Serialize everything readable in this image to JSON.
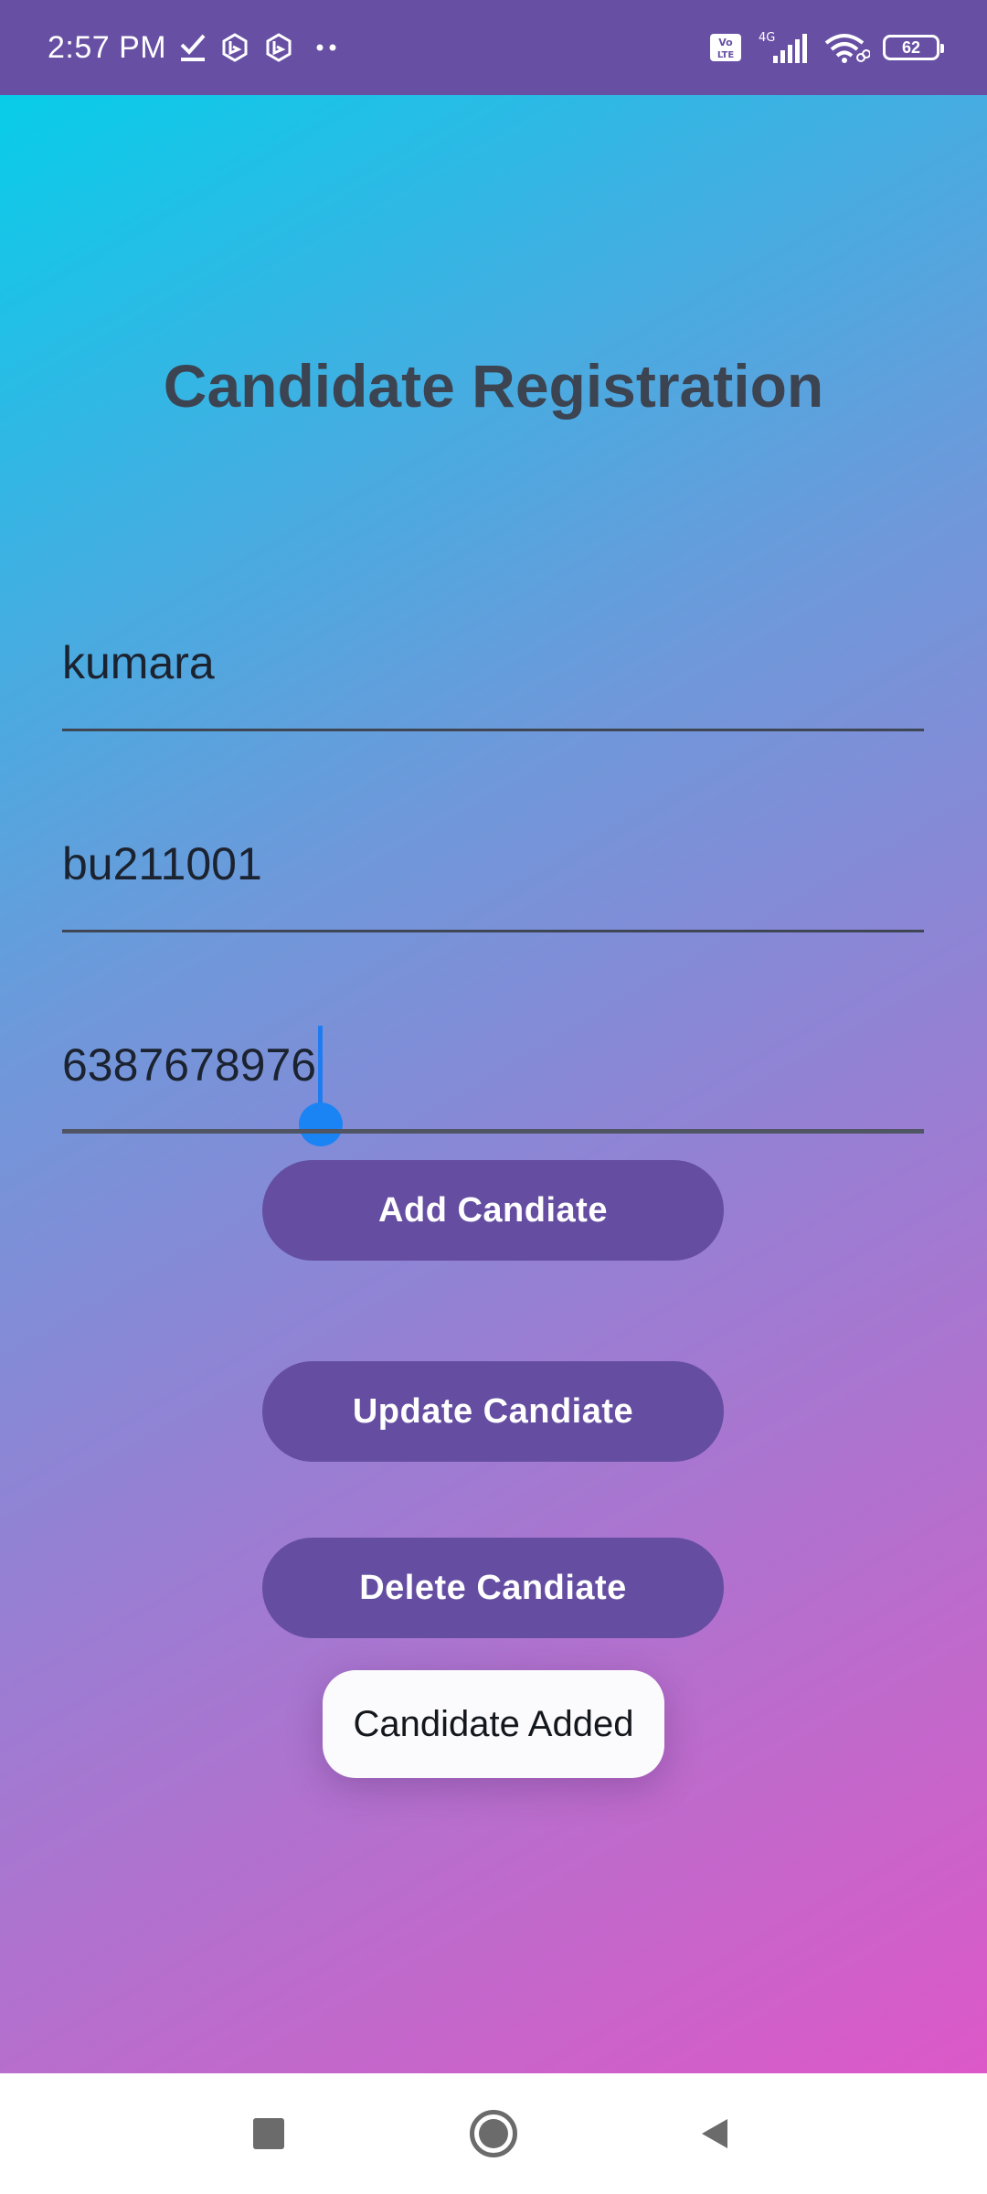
{
  "status_bar": {
    "time": "2:57 PM",
    "network_type": "4G",
    "volte_badge": "Vo LTE",
    "battery_level": "62",
    "icons": [
      "check-icon",
      "app-notification-icon",
      "app-notification-icon",
      "more-dots-icon",
      "volte-icon",
      "signal-icon",
      "wifi-icon",
      "battery-icon"
    ]
  },
  "screen": {
    "title": "Candidate Registration"
  },
  "form": {
    "name_value": "kumara",
    "reg_value": "bu211001",
    "phone_value": "6387678976"
  },
  "buttons": {
    "add_label": "Add Candiate",
    "update_label": "Update Candiate",
    "delete_label": "Delete Candiate"
  },
  "toast": {
    "message": "Candidate Added"
  },
  "nav_bar": {
    "icons": [
      "recents-square-icon",
      "home-circle-icon",
      "back-triangle-icon"
    ]
  },
  "colors": {
    "status_bar": "#6750a4",
    "button": "#654ea1",
    "gradient_start": "#08cde9",
    "gradient_end": "#dc58c8",
    "title_text": "#3c4451",
    "cursor": "#1a84f5"
  }
}
